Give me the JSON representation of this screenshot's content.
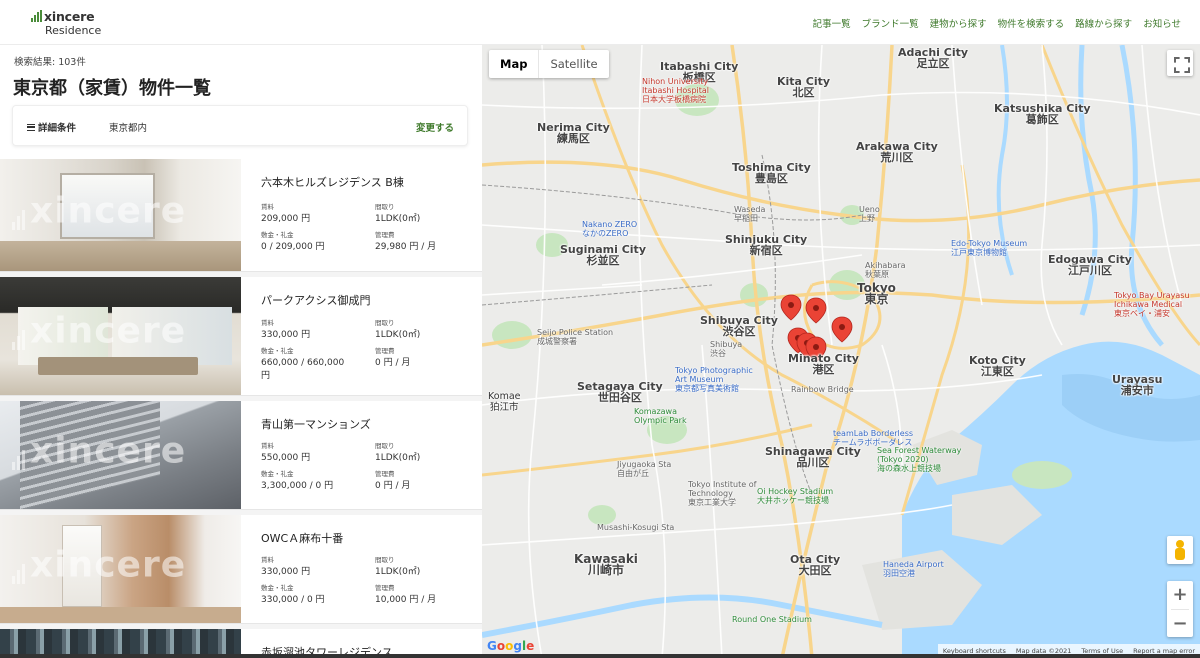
{
  "header": {
    "logo_word": "xincere",
    "logo_sub": "Residence",
    "nav": [
      "記事一覧",
      "ブランド一覧",
      "建物から探す",
      "物件を検索する",
      "路線から探す",
      "お知らせ"
    ]
  },
  "search": {
    "result_count": "検索結果: 103件",
    "title": "東京都（家賃）物件一覧",
    "filter_label": "詳細条件",
    "filter_value": "東京都内",
    "filter_change": "変更する"
  },
  "listings": [
    {
      "name": "六本木ヒルズレジデンス B棟",
      "rent_label": "賃料",
      "rent": "209,000 円",
      "layout_label": "間取り",
      "layout": "1LDK(0㎡)",
      "deposit_label": "敷金・礼金",
      "deposit": "0 / 209,000 円",
      "fee_label": "管理費",
      "fee": "29,980 円 / 月"
    },
    {
      "name": "パークアクシス御成門",
      "rent_label": "賃料",
      "rent": "330,000 円",
      "layout_label": "間取り",
      "layout": "1LDK(0㎡)",
      "deposit_label": "敷金・礼金",
      "deposit": "660,000 / 660,000 円",
      "fee_label": "管理費",
      "fee": "0 円 / 月"
    },
    {
      "name": "青山第一マンションズ",
      "rent_label": "賃料",
      "rent": "550,000 円",
      "layout_label": "間取り",
      "layout": "1LDK(0㎡)",
      "deposit_label": "敷金・礼金",
      "deposit": "3,300,000 / 0 円",
      "fee_label": "管理費",
      "fee": "0 円 / 月"
    },
    {
      "name": "OWCＡ麻布十番",
      "rent_label": "賃料",
      "rent": "330,000 円",
      "layout_label": "間取り",
      "layout": "1LDK(0㎡)",
      "deposit_label": "敷金・礼金",
      "deposit": "330,000 / 0 円",
      "fee_label": "管理費",
      "fee": "10,000 円 / 月"
    },
    {
      "name": "赤坂溜池タワーレジデンス"
    }
  ],
  "map": {
    "type_map": "Map",
    "type_satellite": "Satellite",
    "zoom_in": "+",
    "zoom_out": "−",
    "google": [
      "G",
      "o",
      "o",
      "g",
      "l",
      "e"
    ],
    "attribution": [
      "Keyboard shortcuts",
      "Map data ©2021",
      "Terms of Use",
      "Report a map error"
    ],
    "cities": [
      {
        "en": "Itabashi City",
        "ja": "板橋区"
      },
      {
        "en": "Kita City",
        "ja": "北区"
      },
      {
        "en": "Adachi City",
        "ja": "足立区"
      },
      {
        "en": "Nerima City",
        "ja": "練馬区"
      },
      {
        "en": "Toshima City",
        "ja": "豊島区"
      },
      {
        "en": "Arakawa City",
        "ja": "荒川区"
      },
      {
        "en": "Katsushika City",
        "ja": "葛飾区"
      },
      {
        "en": "Suginami City",
        "ja": "杉並区"
      },
      {
        "en": "Shinjuku City",
        "ja": "新宿区"
      },
      {
        "en": "Edogawa City",
        "ja": "江戸川区"
      },
      {
        "en": "Tokyo",
        "ja": "東京"
      },
      {
        "en": "Shibuya City",
        "ja": "渋谷区"
      },
      {
        "en": "Minato City",
        "ja": "港区"
      },
      {
        "en": "Koto City",
        "ja": "江東区"
      },
      {
        "en": "Setagaya City",
        "ja": "世田谷区"
      },
      {
        "en": "Shinagawa City",
        "ja": "品川区"
      },
      {
        "en": "Ota City",
        "ja": "大田区"
      },
      {
        "en": "Kawasaki",
        "ja": "川崎市"
      },
      {
        "en": "Urayasu",
        "ja": "浦安市"
      },
      {
        "en": "Komae",
        "ja": "狛江市"
      }
    ],
    "pois": [
      {
        "text": "Nihon University\nItabashi Hospital",
        "ja": "日本大学板橋病院",
        "cls": "poi-red"
      },
      {
        "text": "Nakano ZERO",
        "ja": "なかのZERO",
        "cls": "poi-blue"
      },
      {
        "text": "Edo-Tokyo Museum",
        "ja": "江戸東京博物館",
        "cls": "poi-blue"
      },
      {
        "text": "Tokyo Bay Urayasu\nIchikawa Medical",
        "ja": "東京ベイ・浦安",
        "cls": "poi-red"
      },
      {
        "text": "Tokyo Photographic\nArt Museum",
        "ja": "東京都写真美術館",
        "cls": "poi-blue"
      },
      {
        "text": "Komazawa\nOlympic Park",
        "ja": "",
        "cls": "poi-green"
      },
      {
        "text": "Rainbow Bridge",
        "ja": "",
        "cls": "poi-gray"
      },
      {
        "text": "teamLab Borderless",
        "ja": "チームラボボーダレス",
        "cls": "poi-blue"
      },
      {
        "text": "Sea Forest Waterway\n(Tokyo 2020)",
        "ja": "海の森水上競技場",
        "cls": "poi-green"
      },
      {
        "text": "Oi Hockey Stadium",
        "ja": "大井ホッケー競技場",
        "cls": "poi-green"
      },
      {
        "text": "Tokyo Institute of\nTechnology",
        "ja": "東京工業大学",
        "cls": "poi-gray"
      },
      {
        "text": "Haneda Airport",
        "ja": "羽田空港",
        "cls": "poi-blue"
      },
      {
        "text": "Round One Stadium",
        "ja": "",
        "cls": "poi-green"
      },
      {
        "text": "Seijo Police Station",
        "ja": "成城警察署",
        "cls": "poi-gray"
      },
      {
        "text": "Musashi-Kosugi Sta",
        "ja": "",
        "cls": "poi-gray"
      },
      {
        "text": "Jiyugaoka Sta",
        "ja": "自由が丘",
        "cls": "poi-gray"
      },
      {
        "text": "Shibuya",
        "ja": "渋谷",
        "cls": "poi-gray"
      },
      {
        "text": "Waseda",
        "ja": "早稲田",
        "cls": "poi-gray"
      },
      {
        "text": "Ueno",
        "ja": "上野",
        "cls": "poi-gray"
      },
      {
        "text": "Akihabara",
        "ja": "秋葉原",
        "cls": "poi-gray"
      }
    ],
    "colors": {
      "land": "#ececea",
      "water": "#aadaff",
      "park": "#c8e6c0",
      "road": "#ffffff",
      "highway": "#f8d58c",
      "pin": "#ea4335"
    }
  }
}
